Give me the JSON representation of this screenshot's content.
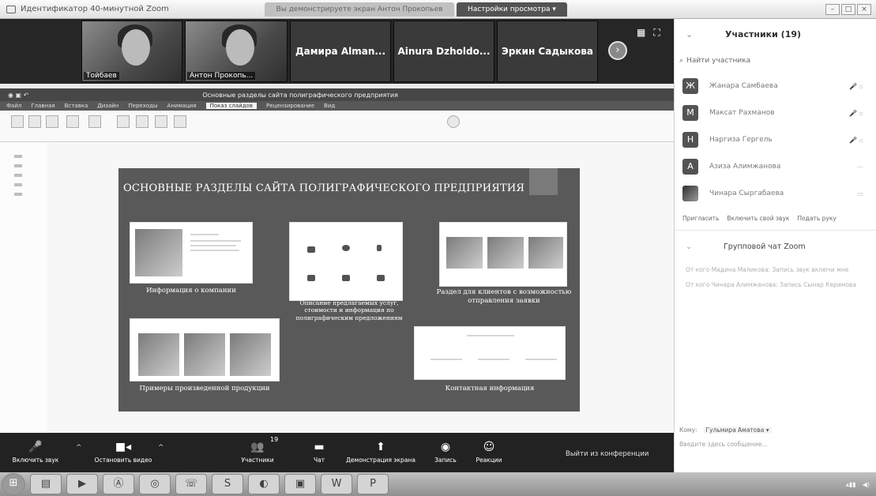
{
  "window": {
    "title": "Идентификатор 40-минутной Zoom",
    "tabs": [
      {
        "label": "Вы демонстрируете экран Антон Прокопьев"
      },
      {
        "label": "Настройки просмотра ▾"
      }
    ]
  },
  "videos": [
    {
      "name": "Тойбаев",
      "type": "cam"
    },
    {
      "name": "Антон Прокопь...",
      "type": "cam"
    },
    {
      "name": "Дамира Alman...",
      "type": "name"
    },
    {
      "name": "Ainura Dzholdo...",
      "type": "name"
    },
    {
      "name": "Эркин Садыкова",
      "type": "name"
    }
  ],
  "powerpoint": {
    "doc_title": "Основные разделы сайта полиграфического предприятия",
    "ribbon_tabs": [
      "Файл",
      "Главная",
      "Вставка",
      "Дизайн",
      "Переходы",
      "Анимация",
      "Показ слайдов",
      "Рецензирование",
      "Вид"
    ],
    "active_tab": "Показ слайдов"
  },
  "slide": {
    "title": "ОСНОВНЫЕ РАЗДЕЛЫ САЙТА ПОЛИГРАФИЧЕСКОГО ПРЕДПРИЯТИЯ",
    "captions": {
      "company": "Информация о компании",
      "services": "Описание предлагаемых услуг, стоимости и информация по полиграфическим предложениям",
      "request": "Раздел для клиентов с возможностью отправления заявки",
      "examples": "Примеры произведенной продукции",
      "contacts": "Контактная информация"
    }
  },
  "participants": {
    "header": "Участники (19)",
    "search_placeholder": "Найти участника",
    "list": [
      {
        "name": "Жанара Самбаева",
        "initial": "Ж"
      },
      {
        "name": "Максат Рахманов",
        "initial": "М"
      },
      {
        "name": "Наргиза Гергель",
        "initial": "Н"
      },
      {
        "name": "Азиза Алимжанова",
        "initial": "А"
      },
      {
        "name": "Чинара Сыргабаева",
        "initial": ""
      }
    ],
    "actions": [
      "Пригласить",
      "Включить свой звук",
      "Подать руку"
    ]
  },
  "chat": {
    "header": "Групповой чат Zoom",
    "messages": [
      "От кого Мадина Маликова: Запись звук включи мне",
      "От кого Чинара Алимжанова: Запись Сынар Керимова"
    ],
    "to_label": "Кому:",
    "to_value": "Гульмира Аматова ▾",
    "input_placeholder": "Введите здесь сообщение..."
  },
  "controls": {
    "audio": "Включить звук",
    "video": "Остановить видео",
    "participants": "Участники",
    "participants_count": "19",
    "chat": "Чат",
    "share": "Демонстрация экрана",
    "record": "Запись",
    "reactions": "Реакции",
    "leave": "Выйти из конференции"
  }
}
